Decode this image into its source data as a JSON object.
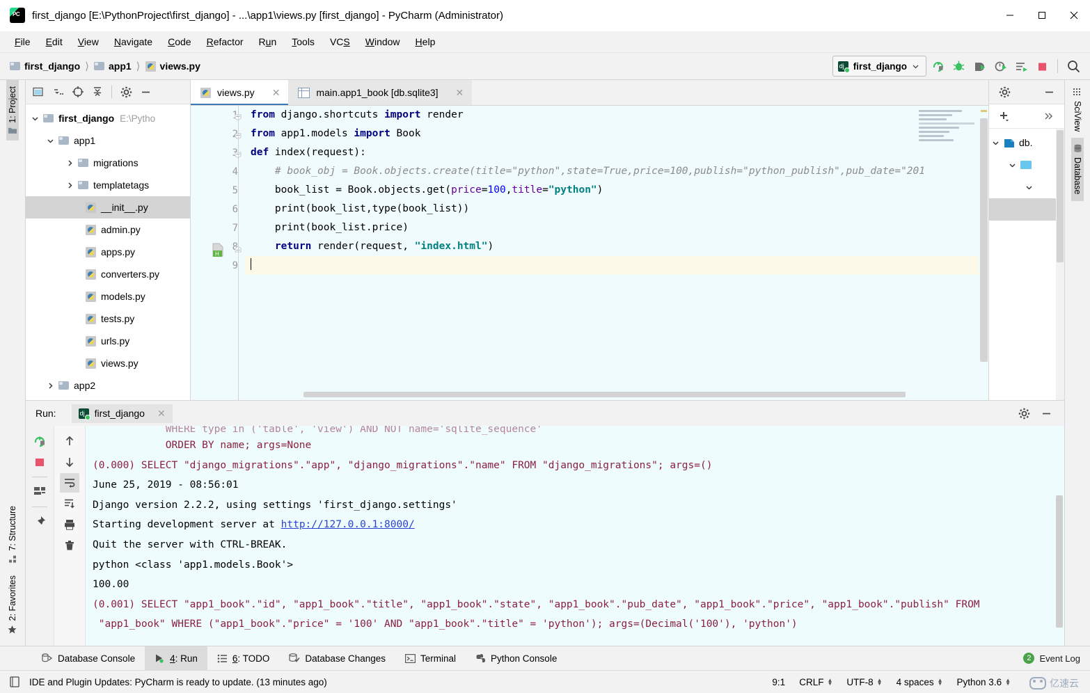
{
  "window": {
    "title": "first_django [E:\\PythonProject\\first_django] - ...\\app1\\views.py [first_django] - PyCharm (Administrator)",
    "app_icon": "pycharm-icon",
    "minimize": "minimize-icon",
    "maximize": "maximize-icon",
    "close": "close-icon"
  },
  "menubar": {
    "items": [
      "File",
      "Edit",
      "View",
      "Navigate",
      "Code",
      "Refactor",
      "Run",
      "Tools",
      "VCS",
      "Window",
      "Help"
    ]
  },
  "navbar": {
    "breadcrumb": [
      "first_django",
      "app1",
      "views.py"
    ],
    "run_config": "first_django",
    "buttons": [
      "rerun-icon",
      "debug-icon",
      "coverage-icon",
      "profile-icon",
      "run-with-console-icon",
      "stop-icon",
      "search-everywhere-icon"
    ]
  },
  "left_strip": {
    "project_tab": "1: Project",
    "structure_tab": "7: Structure",
    "favorites_tab": "2: Favorites"
  },
  "right_strip": {
    "sciview_tab": "SciView",
    "database_tab": "Database"
  },
  "project_panel": {
    "toolbar": [
      "select-opened-file-icon",
      "flatten-packages-icon",
      "locate-icon",
      "collapse-all-icon",
      "settings-icon",
      "hide-icon"
    ],
    "tree": [
      {
        "label": "first_django",
        "path": "E:\\Pytho",
        "indent": 0,
        "type": "folder-open",
        "expanded": true,
        "bold": true,
        "selected": false
      },
      {
        "label": "app1",
        "path": "",
        "indent": 1,
        "type": "folder-module",
        "expanded": true,
        "bold": false,
        "selected": false
      },
      {
        "label": "migrations",
        "path": "",
        "indent": 2,
        "type": "folder-module",
        "expanded": false,
        "bold": false,
        "selected": false
      },
      {
        "label": "templatetags",
        "path": "",
        "indent": 2,
        "type": "folder-module",
        "expanded": false,
        "bold": false,
        "selected": false
      },
      {
        "label": "__init__.py",
        "path": "",
        "indent": 3,
        "type": "python-file",
        "expanded": null,
        "bold": false,
        "selected": true
      },
      {
        "label": "admin.py",
        "path": "",
        "indent": 3,
        "type": "python-file",
        "expanded": null,
        "bold": false,
        "selected": false
      },
      {
        "label": "apps.py",
        "path": "",
        "indent": 3,
        "type": "python-file",
        "expanded": null,
        "bold": false,
        "selected": false
      },
      {
        "label": "converters.py",
        "path": "",
        "indent": 3,
        "type": "python-file",
        "expanded": null,
        "bold": false,
        "selected": false
      },
      {
        "label": "models.py",
        "path": "",
        "indent": 3,
        "type": "python-file",
        "expanded": null,
        "bold": false,
        "selected": false
      },
      {
        "label": "tests.py",
        "path": "",
        "indent": 3,
        "type": "python-file",
        "expanded": null,
        "bold": false,
        "selected": false
      },
      {
        "label": "urls.py",
        "path": "",
        "indent": 3,
        "type": "python-file",
        "expanded": null,
        "bold": false,
        "selected": false
      },
      {
        "label": "views.py",
        "path": "",
        "indent": 3,
        "type": "python-file",
        "expanded": null,
        "bold": false,
        "selected": false
      },
      {
        "label": "app2",
        "path": "",
        "indent": 1,
        "type": "folder-module",
        "expanded": false,
        "bold": false,
        "selected": false
      }
    ]
  },
  "editor": {
    "tabs": [
      {
        "label": "views.py",
        "icon": "python-file-icon",
        "active": true
      },
      {
        "label": "main.app1_book [db.sqlite3]",
        "icon": "table-icon",
        "active": false
      }
    ],
    "line_numbers": [
      "1",
      "2",
      "3",
      "4",
      "5",
      "6",
      "7",
      "8",
      "9"
    ],
    "caret_line": 9,
    "code_lines": [
      {
        "n": 1,
        "tokens": [
          {
            "t": "from",
            "c": "k"
          },
          {
            "t": " django.shortcuts ",
            "c": ""
          },
          {
            "t": "import",
            "c": "k"
          },
          {
            "t": " render",
            "c": ""
          }
        ]
      },
      {
        "n": 2,
        "tokens": [
          {
            "t": "from",
            "c": "k"
          },
          {
            "t": " app1.models ",
            "c": ""
          },
          {
            "t": "import",
            "c": "k"
          },
          {
            "t": " Book",
            "c": ""
          }
        ]
      },
      {
        "n": 3,
        "tokens": [
          {
            "t": "def",
            "c": "k"
          },
          {
            "t": " index(request):",
            "c": ""
          }
        ]
      },
      {
        "n": 4,
        "tokens": [
          {
            "t": "    # book_obj = Book.objects.create(title=\"python\",state=True,price=100,publish=\"python_publish\",pub_date=\"201",
            "c": "cmt"
          }
        ]
      },
      {
        "n": 5,
        "tokens": [
          {
            "t": "    book_list = Book.objects.get(",
            "c": ""
          },
          {
            "t": "price",
            "c": "kw-arg"
          },
          {
            "t": "=",
            "c": ""
          },
          {
            "t": "100",
            "c": "num"
          },
          {
            "t": ",",
            "c": ""
          },
          {
            "t": "title",
            "c": "kw-arg"
          },
          {
            "t": "=",
            "c": ""
          },
          {
            "t": "\"python\"",
            "c": "str"
          },
          {
            "t": ")",
            "c": ""
          }
        ]
      },
      {
        "n": 6,
        "tokens": [
          {
            "t": "    print(book_list,type(book_list))",
            "c": ""
          }
        ]
      },
      {
        "n": 7,
        "tokens": [
          {
            "t": "    print(book_list.price)",
            "c": ""
          }
        ]
      },
      {
        "n": 8,
        "tokens": [
          {
            "t": "    ",
            "c": ""
          },
          {
            "t": "return",
            "c": "k"
          },
          {
            "t": " render(request, ",
            "c": ""
          },
          {
            "t": "\"index.html\"",
            "c": "str"
          },
          {
            "t": ")",
            "c": ""
          }
        ]
      },
      {
        "n": 9,
        "tokens": []
      }
    ]
  },
  "database_panel": {
    "toolbar_settings": "settings-icon",
    "toolbar_hide": "hide-icon",
    "add_button": "add-icon",
    "expand_button": "expand-icon",
    "items": [
      {
        "label": "db.",
        "icon": "datasource-icon",
        "indent": 0,
        "expanded": true
      },
      {
        "label": "",
        "icon": "schema-folder-icon",
        "indent": 1,
        "expanded": true
      },
      {
        "label": "",
        "icon": "",
        "indent": 2,
        "expanded": true
      }
    ]
  },
  "run_window": {
    "label": "Run:",
    "tab": "first_django",
    "tab_icon": "django-icon",
    "close_icon": "close-icon",
    "settings_icon": "settings-icon",
    "hide_icon": "hide-icon",
    "left_tools": [
      "rerun-icon",
      "stop-icon",
      "restore-layout-icon",
      "pin-icon"
    ],
    "left_tools2": [
      "up-icon",
      "down-icon",
      "soft-wrap-icon",
      "scroll-to-end-icon",
      "print-icon",
      "clear-all-icon"
    ],
    "console_lines": [
      {
        "text": "            WHERE type in ('table', 'view') AND NOT name='sqlite_sequence'",
        "cls": "sqlc",
        "clipped": true
      },
      {
        "text": "            ORDER BY name; args=None",
        "cls": "sqlc"
      },
      {
        "text": "(0.000) SELECT \"django_migrations\".\"app\", \"django_migrations\".\"name\" FROM \"django_migrations\"; args=()",
        "cls": "sqlc"
      },
      {
        "text": "June 25, 2019 - 08:56:01",
        "cls": ""
      },
      {
        "text": "Django version 2.2.2, using settings 'first_django.settings'",
        "cls": ""
      },
      {
        "text": "Starting development server at ",
        "cls": "",
        "link": "http://127.0.0.1:8000/"
      },
      {
        "text": "Quit the server with CTRL-BREAK.",
        "cls": ""
      },
      {
        "text": "python <class 'app1.models.Book'>",
        "cls": ""
      },
      {
        "text": "100.00",
        "cls": ""
      },
      {
        "text": "(0.001) SELECT \"app1_book\".\"id\", \"app1_book\".\"title\", \"app1_book\".\"state\", \"app1_book\".\"pub_date\", \"app1_book\".\"price\", \"app1_book\".\"publish\" FROM",
        "cls": "sqlc"
      },
      {
        "text": " \"app1_book\" WHERE (\"app1_book\".\"price\" = '100' AND \"app1_book\".\"title\" = 'python'); args=(Decimal('100'), 'python')",
        "cls": "sqlc"
      }
    ]
  },
  "bottom_tabs": [
    {
      "label": "Database Console",
      "icon": "database-console-icon",
      "selected": false,
      "mnemonic": ""
    },
    {
      "label": ": Run",
      "icon": "run-icon",
      "selected": true,
      "mnemonic": "4"
    },
    {
      "label": ": TODO",
      "icon": "todo-icon",
      "selected": false,
      "mnemonic": "6"
    },
    {
      "label": "Database Changes",
      "icon": "database-changes-icon",
      "selected": false,
      "mnemonic": ""
    },
    {
      "label": "Terminal",
      "icon": "terminal-icon",
      "selected": false,
      "mnemonic": ""
    },
    {
      "label": "Python Console",
      "icon": "python-console-icon",
      "selected": false,
      "mnemonic": ""
    }
  ],
  "event_log": {
    "label": "Event Log",
    "count": "2"
  },
  "statusbar": {
    "message": "IDE and Plugin Updates: PyCharm is ready to update. (13 minutes ago)",
    "message_icon": "notification-icon",
    "caret_position": "9:1",
    "line_separator": "CRLF",
    "encoding": "UTF-8",
    "indent": "4 spaces",
    "interpreter": "Python 3.6"
  },
  "watermark": {
    "text": "亿速云"
  },
  "colors": {
    "accent": "#3c78b4",
    "editor_bg": "#f0fbfd",
    "console_bg": "#effcfd",
    "caret_line": "#fcf9e8",
    "keyword": "#000080",
    "string": "#008080",
    "number": "#0000ff",
    "kwarg": "#660099",
    "comment": "#8c8c8c",
    "sql_text": "#8b1f3f",
    "link": "#2a42d0",
    "selection": "#d4d4d4",
    "stop_red": "#e9546b",
    "run_green": "#3ac162"
  }
}
